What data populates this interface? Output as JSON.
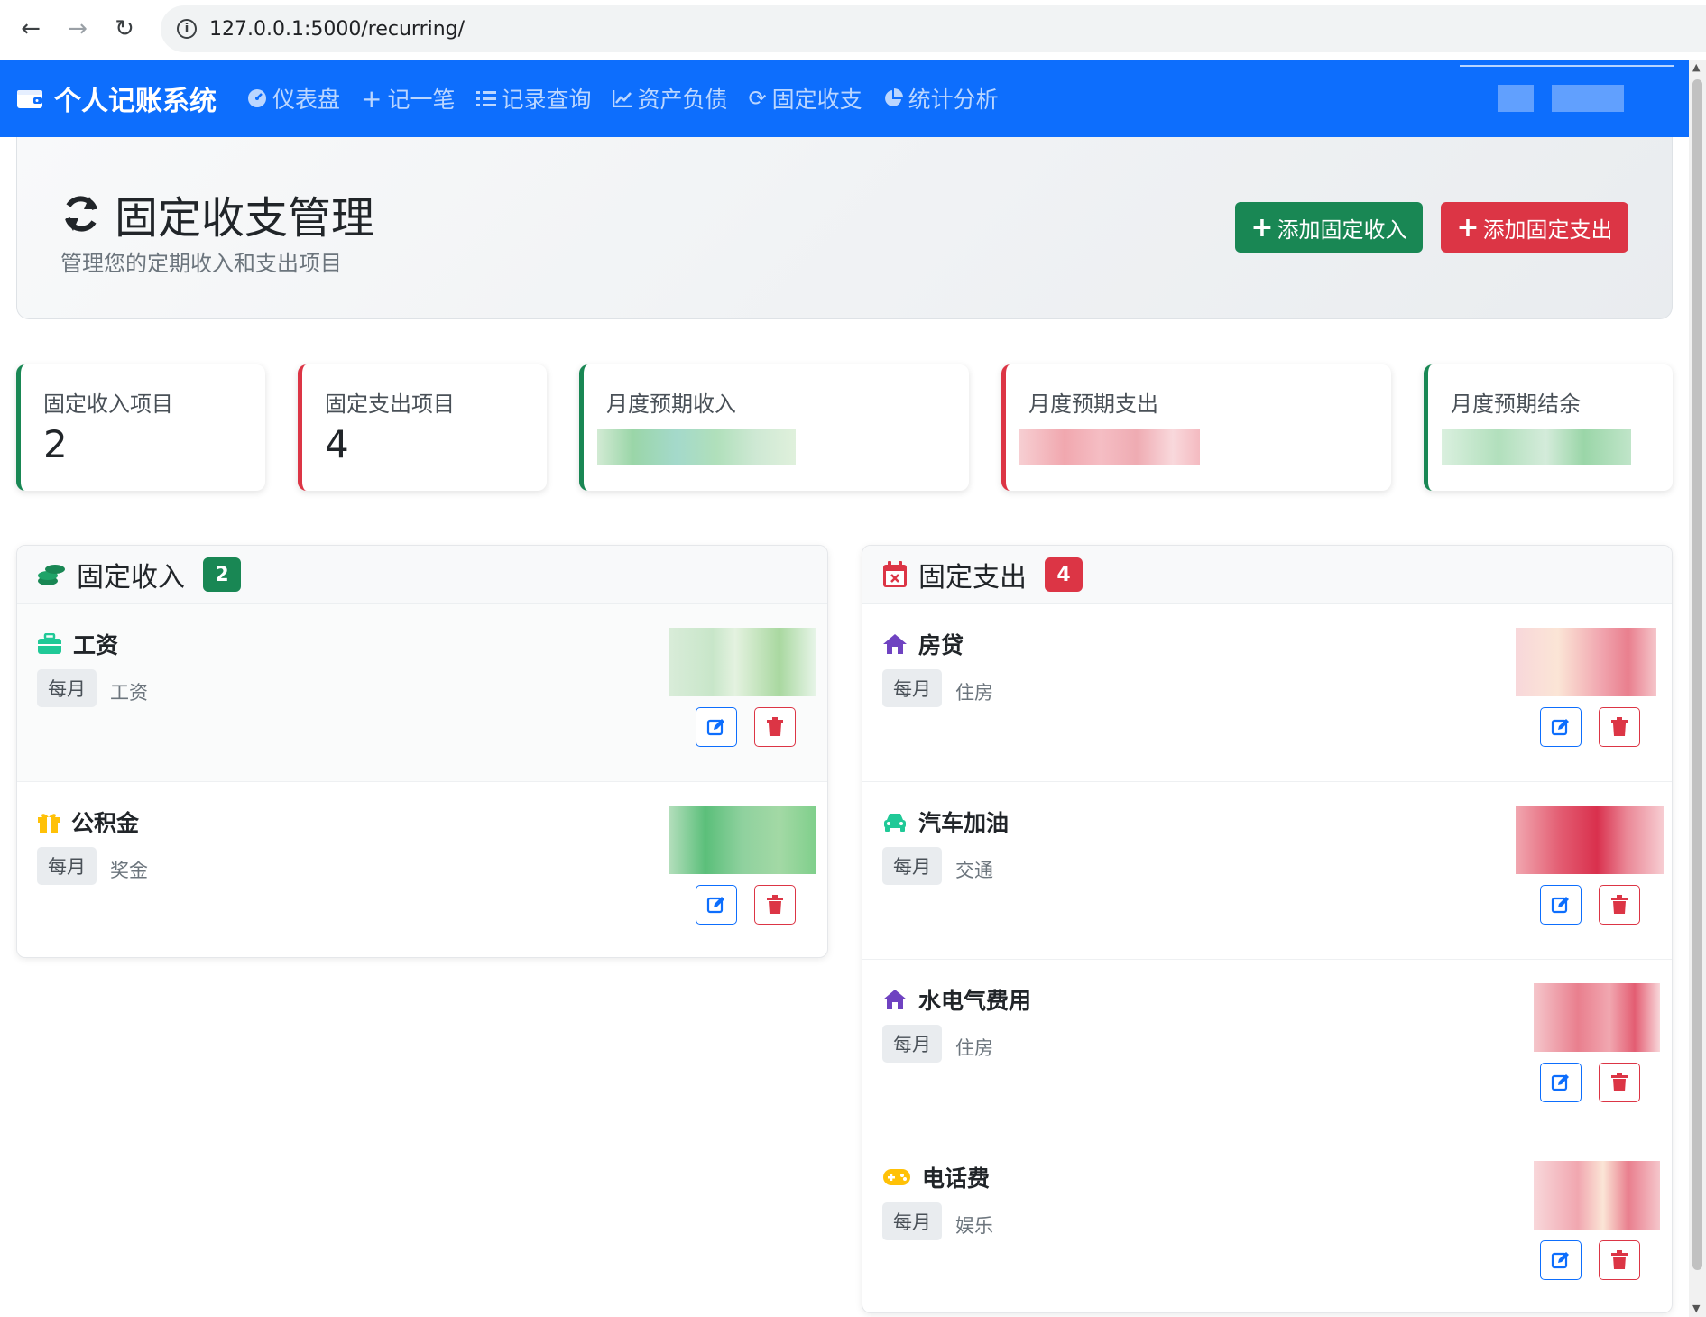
{
  "browser": {
    "url": "127.0.0.1:5000/recurring/"
  },
  "navbar": {
    "brand": "个人记账系统",
    "items": [
      {
        "label": "仪表盘",
        "icon": "dashboard-icon"
      },
      {
        "label": "记一笔",
        "icon": "plus-icon"
      },
      {
        "label": "记录查询",
        "icon": "list-icon"
      },
      {
        "label": "资产负债",
        "icon": "chart-line-icon"
      },
      {
        "label": "固定收支",
        "icon": "sync-icon"
      },
      {
        "label": "统计分析",
        "icon": "pie-chart-icon"
      }
    ]
  },
  "header": {
    "title": "固定收支管理",
    "subtitle": "管理您的定期收入和支出项目",
    "add_income_label": "添加固定收入",
    "add_expense_label": "添加固定支出"
  },
  "stats": {
    "income_items_label": "固定收入项目",
    "income_items_count": "2",
    "expense_items_label": "固定支出项目",
    "expense_items_count": "4",
    "monthly_income_label": "月度预期收入",
    "monthly_expense_label": "月度预期支出",
    "monthly_balance_label": "月度预期结余"
  },
  "income_panel": {
    "title": "固定收入",
    "count": "2",
    "items": [
      {
        "name": "工资",
        "frequency": "每月",
        "category": "工资",
        "icon": "briefcase-icon"
      },
      {
        "name": "公积金",
        "frequency": "每月",
        "category": "奖金",
        "icon": "gift-icon"
      }
    ]
  },
  "expense_panel": {
    "title": "固定支出",
    "count": "4",
    "items": [
      {
        "name": "房贷",
        "frequency": "每月",
        "category": "住房",
        "icon": "home-icon"
      },
      {
        "name": "汽车加油",
        "frequency": "每月",
        "category": "交通",
        "icon": "car-icon"
      },
      {
        "name": "水电气费用",
        "frequency": "每月",
        "category": "住房",
        "icon": "home-icon"
      },
      {
        "name": "电话费",
        "frequency": "每月",
        "category": "娱乐",
        "icon": "gamepad-icon"
      }
    ]
  },
  "colors": {
    "primary": "#0d6efd",
    "success": "#198754",
    "danger": "#dc3545"
  }
}
